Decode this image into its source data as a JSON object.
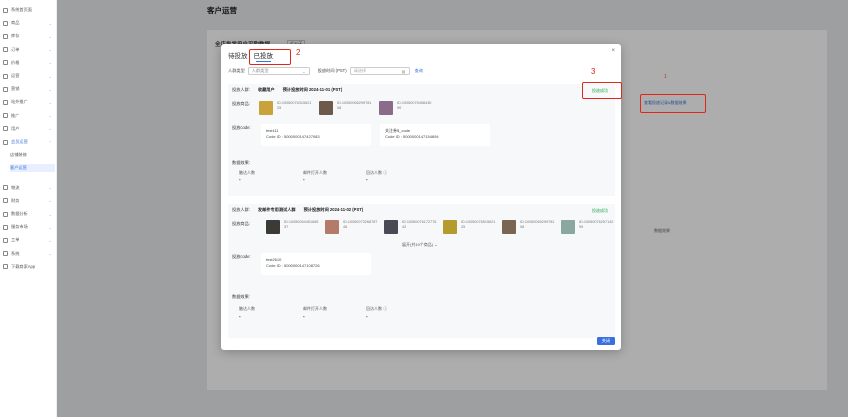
{
  "sidebar": {
    "items": [
      {
        "label": "系统首页面",
        "chev": ""
      },
      {
        "label": "商品",
        "chev": "⌄"
      },
      {
        "label": "库存",
        "chev": "⌄"
      },
      {
        "label": "订单",
        "chev": "⌄"
      },
      {
        "label": "价格",
        "chev": "⌄"
      },
      {
        "label": "运营",
        "chev": "⌄"
      },
      {
        "label": "营销",
        "chev": "⌄"
      },
      {
        "label": "站外推广",
        "chev": "⌄"
      },
      {
        "label": "推广",
        "chev": "⌄"
      },
      {
        "label": "用户",
        "chev": "⌄"
      },
      {
        "label": "会员运营",
        "chev": "⌃"
      }
    ],
    "sub_items": [
      "店铺装修",
      "客户运营"
    ],
    "items_after": [
      {
        "label": "物流",
        "chev": "⌄"
      },
      {
        "label": "财务",
        "chev": "⌄"
      },
      {
        "label": "数据分析",
        "chev": "⌄"
      },
      {
        "label": "服务市场",
        "chev": "⌄"
      },
      {
        "label": "工单",
        "chev": "⌄"
      },
      {
        "label": "系统",
        "chev": "⌄"
      },
      {
        "label": "下载商家App",
        "chev": ""
      }
    ]
  },
  "page": {
    "title": "客户运营"
  },
  "background": {
    "section_title": "全店批发用户采购数据",
    "badge": "近30天",
    "side_link": "查看投放记录&数据效果",
    "col_header": "数据效果"
  },
  "annotations": {
    "n1": "1",
    "n2": "2",
    "n3": "3"
  },
  "modal": {
    "tabs": [
      "待投放",
      "已投放"
    ],
    "close_icon": "×",
    "filter": {
      "type_label": "人群类型",
      "type_placeholder": "人群类型",
      "time_label": "投放时间 (PST)",
      "time_placeholder": "请选择",
      "query": "查询"
    },
    "cards": [
      {
        "crowd_label": "投放人群:",
        "crowd": "收藏用户",
        "time": "预计投放时间 2024-11-01 (PST)",
        "status": "投放成功",
        "products_label": "投放商品:",
        "products": [
          {
            "id": "ID:1005007631562125",
            "color": "#c9a23b"
          },
          {
            "id": "ID:1005006529978108",
            "color": "#6e5a4a"
          },
          {
            "id": "ID:1005007545843090",
            "color": "#8b6a8a"
          }
        ],
        "code_label": "投放code:",
        "codes": [
          {
            "name": "test111",
            "code": "Code ID : 5000000147427083"
          },
          {
            "name": "关注券$_code",
            "code": "Code ID : 5000000147154694"
          }
        ],
        "data_label": "数据效果:",
        "metrics": [
          {
            "label": "触达人数",
            "value": "-"
          },
          {
            "label": "邮件打开人数",
            "value": "-"
          },
          {
            "label": "回访人数 ⓘ",
            "value": "-"
          }
        ]
      },
      {
        "crowd_label": "投放人群:",
        "crowd": "发邮件专用测试人群",
        "time": "预计投放时间 2024-11-02 (PST)",
        "status": "投放成功",
        "products_label": "投放商品:",
        "products": [
          {
            "id": "ID:1005005445166537",
            "color": "#3c3a36"
          },
          {
            "id": "ID:1005007326878746",
            "color": "#b47a6a"
          },
          {
            "id": "ID:1005007617277642",
            "color": "#4a4a55"
          },
          {
            "id": "ID:1005007651562125",
            "color": "#b59a2e"
          },
          {
            "id": "ID:1005006529978108",
            "color": "#7a6552"
          },
          {
            "id": "ID:1005007625714299",
            "color": "#8aa8a0"
          }
        ],
        "expand": "展开(共19个商品) ⌄",
        "code_label": "投放code:",
        "codes": [
          {
            "name": "test2610",
            "code": "Code ID : 5000000147108726"
          }
        ],
        "data_label": "数据效果:",
        "metrics": [
          {
            "label": "触达人数",
            "value": "-"
          },
          {
            "label": "邮件打开人数",
            "value": "-"
          },
          {
            "label": "回访人数 ⓘ",
            "value": "-"
          }
        ]
      }
    ],
    "close_button": "关闭"
  }
}
